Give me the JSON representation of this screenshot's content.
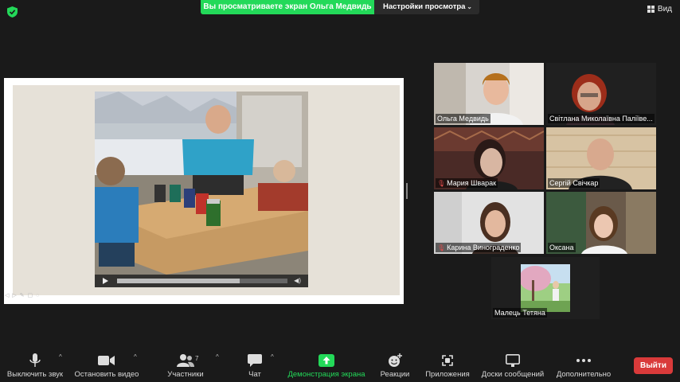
{
  "top": {
    "share_banner": "Вы просматриваете экран Ольга Медвидь",
    "view_settings": "Настройки просмотра",
    "view_button": "Вид"
  },
  "participants": [
    {
      "name": "Ольга Медвидь",
      "muted": false
    },
    {
      "name": "Світлана Миколаївна Паліїве...",
      "muted": false
    },
    {
      "name": "Мария Шварак",
      "muted": true
    },
    {
      "name": "Сергій Свічкар",
      "muted": false
    },
    {
      "name": "Карина Винограденко",
      "muted": true
    },
    {
      "name": "Оксана",
      "muted": false,
      "active": true
    },
    {
      "name": "Малець Тетяна",
      "muted": false
    }
  ],
  "video": {
    "progress": 0.72
  },
  "toolbar": {
    "mute": "Выключить звук",
    "stop_video": "Остановить видео",
    "participants": "Участники",
    "participants_count": "7",
    "chat": "Чат",
    "share_screen": "Демонстрация экрана",
    "reactions": "Реакции",
    "apps": "Приложения",
    "whiteboards": "Доски сообщений",
    "more": "Дополнительно",
    "leave": "Выйти"
  },
  "colors": {
    "accent_green": "#23d959",
    "leave_red": "#d93a3a",
    "active_speaker": "#d9e05a"
  },
  "icons": [
    "shield-icon",
    "grid-icon",
    "microphone-icon",
    "camera-icon",
    "participants-icon",
    "chat-icon",
    "share-screen-icon",
    "reactions-icon",
    "apps-icon",
    "whiteboard-icon",
    "more-icon"
  ]
}
